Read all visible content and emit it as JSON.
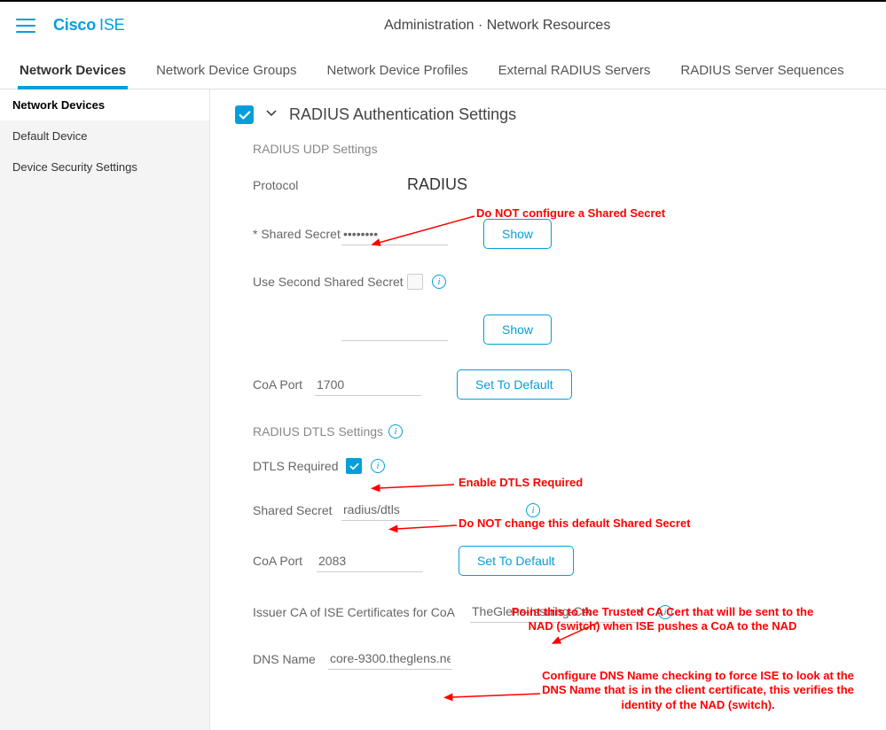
{
  "brand": {
    "b": "Cisco",
    "prod": "ISE"
  },
  "breadcrumb": "Administration · Network Resources",
  "tabs": [
    "Network Devices",
    "Network Device Groups",
    "Network Device Profiles",
    "External RADIUS Servers",
    "RADIUS Server Sequences"
  ],
  "sidebar": [
    "Network Devices",
    "Default Device",
    "Device Security Settings"
  ],
  "section_title": "RADIUS Authentication Settings",
  "udp_hdr": "RADIUS UDP Settings",
  "dtls_hdr": "RADIUS DTLS Settings",
  "labels": {
    "protocol": "Protocol",
    "protocol_val": "RADIUS",
    "shared_secret": "* Shared Secret",
    "use_second": "Use Second Shared Secret",
    "coa_port": "CoA Port",
    "coa_port_val": "1700",
    "dtls_required": "DTLS Required",
    "d_shared_secret": "Shared Secret",
    "d_shared_secret_val": "radius/dtls",
    "d_coa_port": "CoA Port",
    "d_coa_port_val": "2083",
    "issuer": "Issuer CA of ISE Certificates for CoA",
    "issuer_val": "TheGlens-Issuing-CA",
    "dns": "DNS Name",
    "dns_val": "core-9300.theglens.ne"
  },
  "buttons": {
    "show": "Show",
    "set_default": "Set To Default"
  },
  "annotations": {
    "a1": "Do NOT configure a Shared Secret",
    "a2": "Enable DTLS Required",
    "a3": "Do NOT change this default Shared Secret",
    "a4": "Point this to the Trusted CA Cert that will be sent to the NAD (switch) when ISE pushes a CoA to the NAD",
    "a5": "Configure DNS Name checking to force ISE to look at the DNS Name that is in the client certificate, this verifies the identity of the NAD (switch)."
  }
}
